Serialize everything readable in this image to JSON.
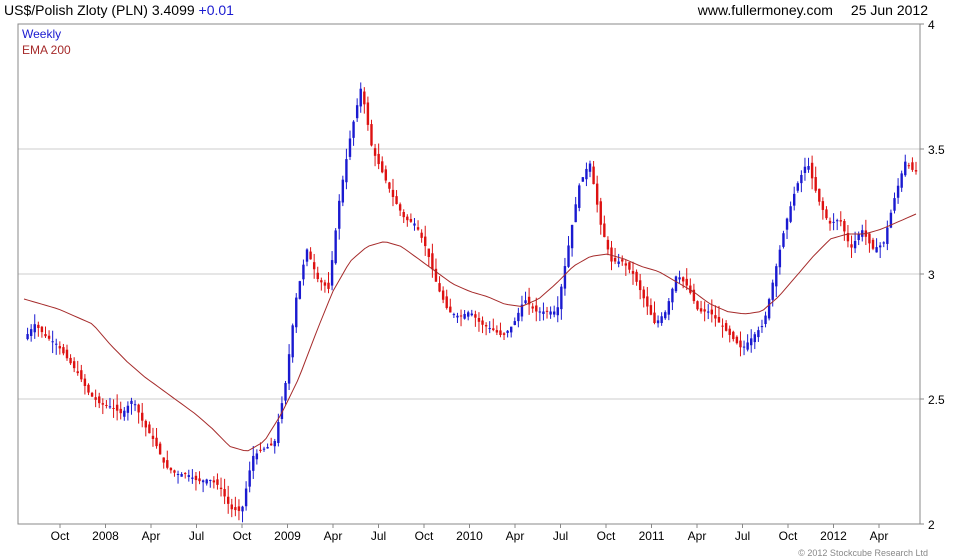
{
  "header": {
    "instrument": "US$/Polish Zloty (PLN)",
    "last_price": "3.4099",
    "change": "+0.01",
    "website": "www.fullermoney.com",
    "date": "25 Jun 2012"
  },
  "legend": {
    "weekly": "Weekly",
    "ema": "EMA 200"
  },
  "credit": "© 2012 Stockcube Research Ltd",
  "colors": {
    "up": "#1a1ad0",
    "down": "#dd1111",
    "ema": "#a52a2a",
    "grid": "#cccccc",
    "frame": "#888888"
  },
  "chart_data": {
    "type": "candlestick",
    "interval": "weekly",
    "y_axis_side": "right",
    "ylim": [
      2,
      4
    ],
    "y_ticks": [
      2,
      2.5,
      3,
      3.5,
      4
    ],
    "grid": true,
    "x_tick_labels": [
      "Oct",
      "2008",
      "Apr",
      "Jul",
      "Oct",
      "2009",
      "Apr",
      "Jul",
      "Oct",
      "2010",
      "Apr",
      "Jul",
      "Oct",
      "2011",
      "Apr",
      "Jul",
      "Oct",
      "2012",
      "Apr"
    ],
    "price_path": {
      "x_period": "2007-07 to 2012-06",
      "y": [
        2.74,
        2.8,
        2.75,
        2.72,
        2.66,
        2.6,
        2.52,
        2.48,
        2.47,
        2.44,
        2.5,
        2.4,
        2.33,
        2.23,
        2.2,
        2.2,
        2.17,
        2.18,
        2.15,
        2.06,
        2.05,
        2.27,
        2.3,
        2.32,
        2.55,
        2.9,
        3.1,
        2.98,
        2.94,
        3.3,
        3.55,
        3.75,
        3.5,
        3.4,
        3.3,
        3.22,
        3.2,
        3.1,
        2.95,
        2.85,
        2.83,
        2.85,
        2.8,
        2.78,
        2.75,
        2.8,
        2.9,
        2.85,
        2.85,
        2.85,
        3.1,
        3.35,
        3.45,
        3.2,
        3.05,
        3.05,
        3.0,
        2.9,
        2.8,
        2.85,
        3.0,
        2.95,
        2.85,
        2.85,
        2.8,
        2.75,
        2.7,
        2.75,
        2.8,
        3.0,
        3.2,
        3.35,
        3.45,
        3.3,
        3.2,
        3.22,
        3.1,
        3.18,
        3.1,
        3.12,
        3.3,
        3.45,
        3.4
      ],
      "close": 3.4099
    },
    "ema_200": {
      "y": [
        2.9,
        2.88,
        2.86,
        2.83,
        2.8,
        2.72,
        2.65,
        2.59,
        2.54,
        2.49,
        2.44,
        2.38,
        2.31,
        2.29,
        2.33,
        2.44,
        2.58,
        2.76,
        2.93,
        3.05,
        3.11,
        3.13,
        3.11,
        3.06,
        3.01,
        2.96,
        2.93,
        2.91,
        2.88,
        2.87,
        2.9,
        2.96,
        3.03,
        3.07,
        3.08,
        3.06,
        3.03,
        3.01,
        2.97,
        2.93,
        2.88,
        2.85,
        2.84,
        2.85,
        2.91,
        2.99,
        3.07,
        3.14,
        3.16,
        3.16,
        3.18,
        3.21,
        3.24
      ]
    }
  }
}
